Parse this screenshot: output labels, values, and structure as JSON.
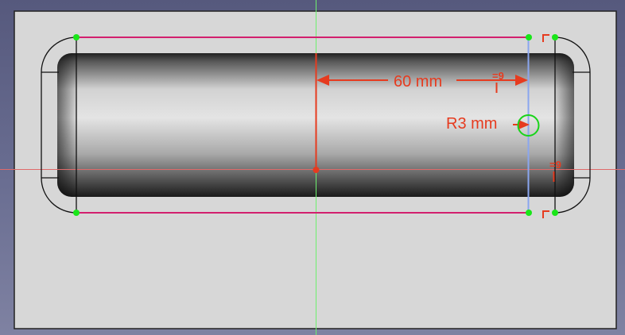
{
  "sketch": {
    "dimension_length": "60 mm",
    "dimension_radius": "R3 mm",
    "constraint_labels": [
      "=9",
      "=9"
    ],
    "icons": {
      "horizontal_constraint": "horizontal-constraint-icon",
      "equal_constraint": "equal-constraint-icon",
      "vertex": "sketch-vertex-icon"
    }
  },
  "colors": {
    "background_top": "#56597d",
    "background_bottom": "#7f82a2",
    "plate_face": "#d7d7d7",
    "sketch_edge": "#d21f6e",
    "selected_edge": "#8aa6ef",
    "vertex": "#19e619",
    "dimension": "#e63b1f",
    "x_axis": "#e06a6a",
    "y_axis": "#6ef06e",
    "preselect_circle": "#19d419"
  }
}
